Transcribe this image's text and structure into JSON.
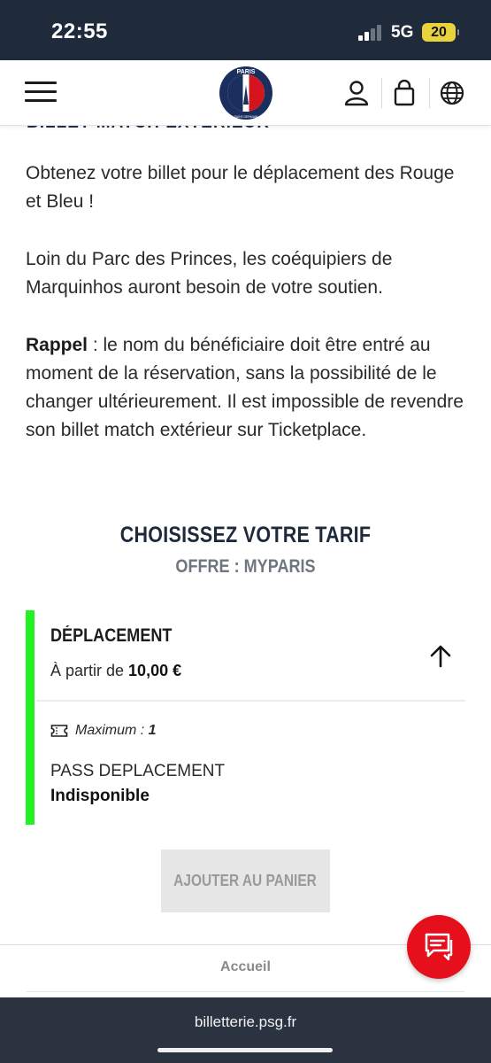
{
  "status_bar": {
    "time": "22:55",
    "network": "5G",
    "battery": "20",
    "battery_color": "#e9d33c"
  },
  "header": {
    "menu_icon": "hamburger-menu-icon",
    "logo_text": "PARIS",
    "logo_subtext": "SAINT-GERMAIN",
    "icons": [
      "account-icon",
      "bag-icon",
      "globe-icon"
    ]
  },
  "content": {
    "cut_heading": "BILLET MATCH EXTÉRIEUR",
    "paragraph1": "Obtenez votre billet pour le déplacement des Rouge et Bleu !",
    "paragraph2": "Loin du Parc des Princes, les coéquipiers de Marquinhos auront besoin de votre soutien.",
    "reminder_label": "Rappel",
    "reminder_text": " : le nom du bénéficiaire doit être entré au moment de la réservation, sans la possibilité de le changer ultérieurement. Il est impossible de revendre son billet match extérieur sur Ticketplace."
  },
  "tarif": {
    "title": "CHOISISSEZ VOTRE TARIF",
    "subtitle": "OFFRE : MYPARIS"
  },
  "offer": {
    "name": "DÉPLACEMENT",
    "price_prefix": "À partir de ",
    "price": "10,00 €",
    "max_label": "Maximum : ",
    "max_value": "1",
    "pass_name": "PASS DEPLACEMENT",
    "pass_status": "Indisponible",
    "accent_color": "#22f222"
  },
  "actions": {
    "add_to_cart": "AJOUTER AU PANIER"
  },
  "footer": {
    "home": "Accueil"
  },
  "browser": {
    "url": "billetterie.psg.fr"
  },
  "colors": {
    "navy": "#1f2a3b",
    "chat_red": "#e5101c"
  }
}
